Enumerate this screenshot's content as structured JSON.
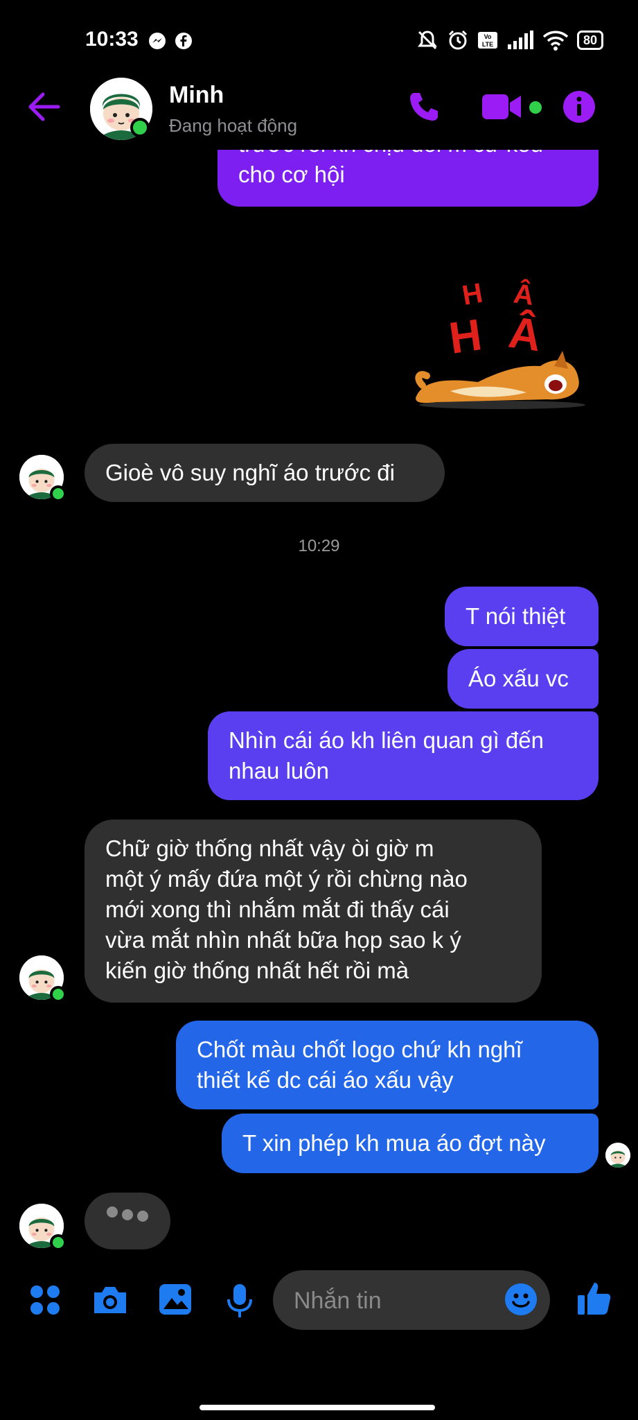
{
  "status_bar": {
    "time": "10:33",
    "battery": "80"
  },
  "header": {
    "name": "Minh",
    "status": "Đang hoạt động"
  },
  "messages": {
    "m1": "trước rồi kh chịu đổi m cứ kêu\ncho cơ hội",
    "m2": "Gioè vô suy nghĩ áo trước đi",
    "time_divider": "10:29",
    "m3": "T nói thiệt",
    "m4": "Áo xấu vc",
    "m5": "Nhìn cái áo kh liên quan gì đến\nnhau luôn",
    "m6": "Chữ giờ thống nhất vậy òi giờ m\nmột ý mấy đứa một ý rồi chừng nào\nmới xong thì nhắm mắt đi thấy cái\nvừa mắt nhìn nhất bữa họp sao k ý\nkiến giờ thống nhất hết rồi mà",
    "m7": "Chốt màu chốt logo chứ kh nghĩ\nthiết kế dc cái áo xấu vậy",
    "m8": "T xin phép kh mua áo đợt này"
  },
  "sticker": {
    "text_top": "H Â",
    "text_bottom": "H Â"
  },
  "composer": {
    "placeholder": "Nhắn tin"
  },
  "colors": {
    "accent": "#9b1cf5",
    "bubble_purple": "#7e1ff2",
    "bubble_violet": "#5a3ff1",
    "bubble_blue": "#2366e8",
    "bubble_incoming": "#303030",
    "toolbar_blue": "#1e7cf0"
  },
  "icons": [
    "back-arrow-icon",
    "phone-icon",
    "video-icon",
    "info-icon",
    "apps-icon",
    "camera-icon",
    "gallery-icon",
    "mic-icon",
    "emoji-icon",
    "like-icon"
  ]
}
